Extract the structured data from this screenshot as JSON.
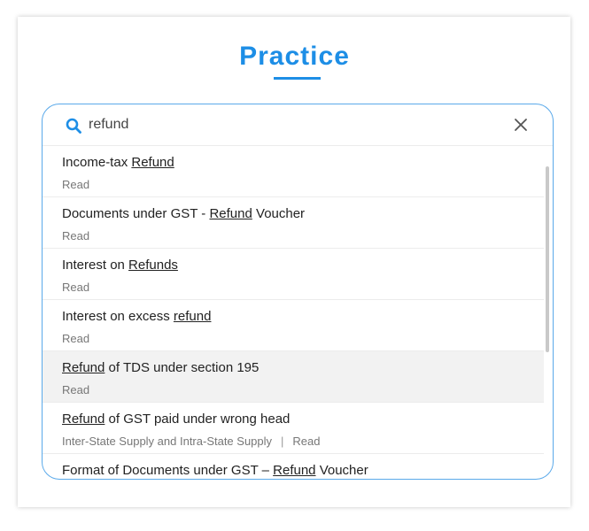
{
  "page": {
    "title": "Practice"
  },
  "search": {
    "value": "refund",
    "placeholder": ""
  },
  "results": [
    {
      "pre": "Income-tax ",
      "match": "Refund",
      "post": "",
      "meta_prefix": "",
      "meta_action": "Read"
    },
    {
      "pre": "Documents under GST - ",
      "match": "Refund",
      "post": " Voucher",
      "meta_prefix": "",
      "meta_action": "Read"
    },
    {
      "pre": "Interest on ",
      "match": "Refunds",
      "post": "",
      "meta_prefix": "",
      "meta_action": "Read"
    },
    {
      "pre": "Interest on excess ",
      "match": "refund",
      "post": "",
      "meta_prefix": "",
      "meta_action": "Read"
    },
    {
      "pre": "",
      "match": "Refund",
      "post": " of TDS under section 195",
      "meta_prefix": "",
      "meta_action": "Read"
    },
    {
      "pre": "",
      "match": "Refund",
      "post": " of GST paid under wrong head",
      "meta_prefix": "Inter-State Supply and Intra-State Supply",
      "meta_action": "Read"
    },
    {
      "pre": "Format of Documents under GST – ",
      "match": "Refund",
      "post": " Voucher",
      "meta_prefix": "",
      "meta_action": ""
    }
  ],
  "meta_separator": "|",
  "colors": {
    "accent": "#1d8ee6",
    "border": "#5aa9ea",
    "highlight_row": "#f2f2f2"
  },
  "icons": {
    "search": "search-icon",
    "close": "close-icon"
  }
}
